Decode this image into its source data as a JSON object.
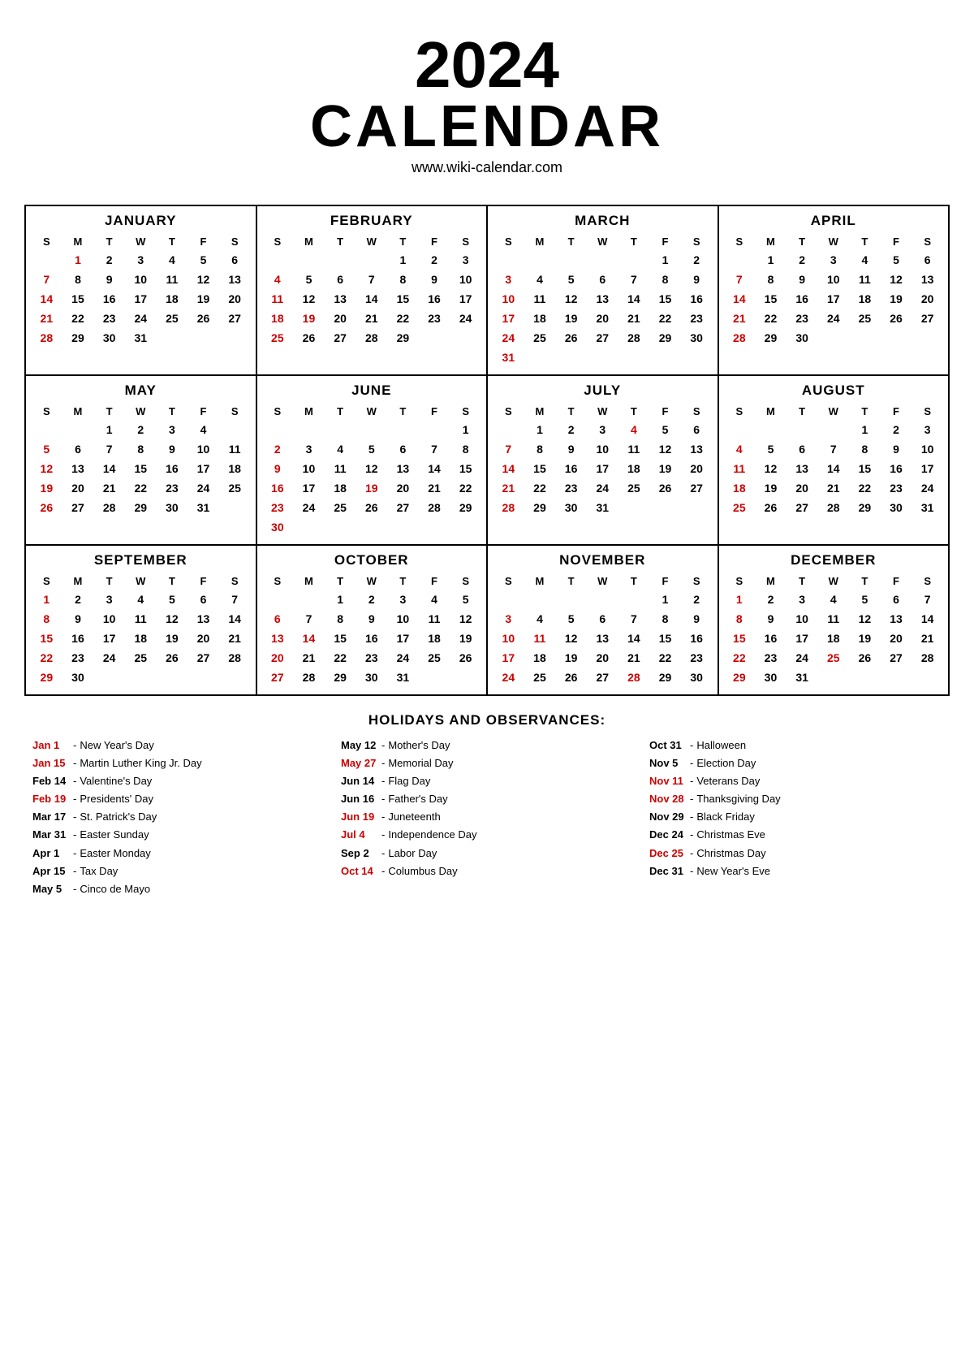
{
  "header": {
    "year": "2024",
    "calendar_word": "CALENDAR",
    "website": "www.wiki-calendar.com"
  },
  "months": [
    {
      "name": "JANUARY",
      "weeks": [
        [
          "",
          1,
          2,
          3,
          4,
          5,
          6
        ],
        [
          7,
          8,
          9,
          10,
          11,
          12,
          13
        ],
        [
          14,
          15,
          16,
          17,
          18,
          19,
          20
        ],
        [
          21,
          22,
          23,
          24,
          25,
          26,
          27
        ],
        [
          28,
          29,
          30,
          31,
          "",
          "",
          ""
        ]
      ]
    },
    {
      "name": "FEBRUARY",
      "weeks": [
        [
          "",
          "",
          "",
          "",
          1,
          2,
          3
        ],
        [
          4,
          5,
          6,
          7,
          8,
          9,
          10
        ],
        [
          11,
          12,
          13,
          14,
          15,
          16,
          17
        ],
        [
          18,
          19,
          20,
          21,
          22,
          23,
          24
        ],
        [
          25,
          26,
          27,
          28,
          29,
          "",
          ""
        ]
      ]
    },
    {
      "name": "MARCH",
      "weeks": [
        [
          "",
          "",
          "",
          "",
          "",
          1,
          2
        ],
        [
          3,
          4,
          5,
          6,
          7,
          8,
          9
        ],
        [
          10,
          11,
          12,
          13,
          14,
          15,
          16
        ],
        [
          17,
          18,
          19,
          20,
          21,
          22,
          23
        ],
        [
          24,
          25,
          26,
          27,
          28,
          29,
          30
        ],
        [
          31,
          "",
          "",
          "",
          "",
          "",
          ""
        ]
      ]
    },
    {
      "name": "APRIL",
      "weeks": [
        [
          "",
          1,
          2,
          3,
          4,
          5,
          6
        ],
        [
          7,
          8,
          9,
          10,
          11,
          12,
          13
        ],
        [
          14,
          15,
          16,
          17,
          18,
          19,
          20
        ],
        [
          21,
          22,
          23,
          24,
          25,
          26,
          27
        ],
        [
          28,
          29,
          30,
          "",
          "",
          "",
          ""
        ]
      ]
    },
    {
      "name": "MAY",
      "weeks": [
        [
          "",
          "",
          1,
          2,
          3,
          4,
          ""
        ],
        [
          5,
          6,
          7,
          8,
          9,
          10,
          11
        ],
        [
          12,
          13,
          14,
          15,
          16,
          17,
          18
        ],
        [
          19,
          20,
          21,
          22,
          23,
          24,
          25
        ],
        [
          26,
          27,
          28,
          29,
          30,
          31,
          ""
        ]
      ]
    },
    {
      "name": "JUNE",
      "weeks": [
        [
          "",
          "",
          "",
          "",
          "",
          "",
          1
        ],
        [
          2,
          3,
          4,
          5,
          6,
          7,
          8
        ],
        [
          9,
          10,
          11,
          12,
          13,
          14,
          15
        ],
        [
          16,
          17,
          18,
          19,
          20,
          21,
          22
        ],
        [
          23,
          24,
          25,
          26,
          27,
          28,
          29
        ],
        [
          30,
          "",
          "",
          "",
          "",
          "",
          ""
        ]
      ]
    },
    {
      "name": "JULY",
      "weeks": [
        [
          "",
          1,
          2,
          3,
          4,
          5,
          6
        ],
        [
          7,
          8,
          9,
          10,
          11,
          12,
          13
        ],
        [
          14,
          15,
          16,
          17,
          18,
          19,
          20
        ],
        [
          21,
          22,
          23,
          24,
          25,
          26,
          27
        ],
        [
          28,
          29,
          30,
          31,
          "",
          "",
          ""
        ]
      ]
    },
    {
      "name": "AUGUST",
      "weeks": [
        [
          "",
          "",
          "",
          "",
          1,
          2,
          3
        ],
        [
          4,
          5,
          6,
          7,
          8,
          9,
          10
        ],
        [
          11,
          12,
          13,
          14,
          15,
          16,
          17
        ],
        [
          18,
          19,
          20,
          21,
          22,
          23,
          24
        ],
        [
          25,
          26,
          27,
          28,
          29,
          30,
          31
        ]
      ]
    },
    {
      "name": "SEPTEMBER",
      "weeks": [
        [
          1,
          2,
          3,
          4,
          5,
          6,
          7
        ],
        [
          8,
          9,
          10,
          11,
          12,
          13,
          14
        ],
        [
          15,
          16,
          17,
          18,
          19,
          20,
          21
        ],
        [
          22,
          23,
          24,
          25,
          26,
          27,
          28
        ],
        [
          29,
          30,
          "",
          "",
          "",
          "",
          ""
        ]
      ]
    },
    {
      "name": "OCTOBER",
      "weeks": [
        [
          "",
          "",
          1,
          2,
          3,
          4,
          5
        ],
        [
          6,
          7,
          8,
          9,
          10,
          11,
          12
        ],
        [
          13,
          14,
          15,
          16,
          17,
          18,
          19
        ],
        [
          20,
          21,
          22,
          23,
          24,
          25,
          26
        ],
        [
          27,
          28,
          29,
          30,
          31,
          "",
          ""
        ]
      ]
    },
    {
      "name": "NOVEMBER",
      "weeks": [
        [
          "",
          "",
          "",
          "",
          "",
          1,
          2
        ],
        [
          3,
          4,
          5,
          6,
          7,
          8,
          9
        ],
        [
          10,
          11,
          12,
          13,
          14,
          15,
          16
        ],
        [
          17,
          18,
          19,
          20,
          21,
          22,
          23
        ],
        [
          24,
          25,
          26,
          27,
          28,
          29,
          30
        ]
      ]
    },
    {
      "name": "DECEMBER",
      "weeks": [
        [
          1,
          2,
          3,
          4,
          5,
          6,
          7
        ],
        [
          8,
          9,
          10,
          11,
          12,
          13,
          14
        ],
        [
          15,
          16,
          17,
          18,
          19,
          20,
          21
        ],
        [
          22,
          23,
          24,
          25,
          26,
          27,
          28
        ],
        [
          29,
          30,
          31,
          "",
          "",
          "",
          ""
        ]
      ]
    }
  ],
  "red_days": {
    "JANUARY": [
      1,
      7,
      14,
      21,
      28
    ],
    "FEBRUARY": [
      4,
      11,
      18,
      25,
      19
    ],
    "MARCH": [
      3,
      10,
      17,
      24,
      31
    ],
    "APRIL": [
      7,
      14,
      21,
      28
    ],
    "MAY": [
      5,
      12,
      19,
      26
    ],
    "JUNE": [
      2,
      9,
      16,
      23,
      30,
      19
    ],
    "JULY": [
      7,
      14,
      21,
      28,
      4
    ],
    "AUGUST": [
      4,
      11,
      18,
      25
    ],
    "SEPTEMBER": [
      1,
      8,
      15,
      22,
      29
    ],
    "OCTOBER": [
      6,
      13,
      20,
      27,
      14
    ],
    "NOVEMBER": [
      3,
      10,
      17,
      24,
      11,
      28
    ],
    "DECEMBER": [
      1,
      8,
      15,
      22,
      29,
      25
    ]
  },
  "day_headers": [
    "S",
    "M",
    "T",
    "W",
    "T",
    "F",
    "S"
  ],
  "holidays_title": "HOLIDAYS AND OBSERVANCES:",
  "holidays": {
    "col1": [
      {
        "date": "Jan 1",
        "red": true,
        "name": "New Year's Day"
      },
      {
        "date": "Jan 15",
        "red": true,
        "name": "Martin Luther King Jr. Day"
      },
      {
        "date": "Feb 14",
        "red": false,
        "name": "Valentine's Day"
      },
      {
        "date": "Feb 19",
        "red": true,
        "name": "Presidents' Day"
      },
      {
        "date": "Mar 17",
        "red": false,
        "name": "St. Patrick's Day"
      },
      {
        "date": "Mar 31",
        "red": false,
        "name": "Easter Sunday"
      },
      {
        "date": "Apr 1",
        "red": false,
        "name": "Easter Monday"
      },
      {
        "date": "Apr 15",
        "red": false,
        "name": "Tax Day"
      },
      {
        "date": "May 5",
        "red": false,
        "name": "Cinco de Mayo"
      }
    ],
    "col2": [
      {
        "date": "May 12",
        "red": false,
        "name": "Mother's Day"
      },
      {
        "date": "May 27",
        "red": true,
        "name": "Memorial Day"
      },
      {
        "date": "Jun 14",
        "red": false,
        "name": "Flag Day"
      },
      {
        "date": "Jun 16",
        "red": false,
        "name": "Father's Day"
      },
      {
        "date": "Jun 19",
        "red": true,
        "name": "Juneteenth"
      },
      {
        "date": "Jul 4",
        "red": true,
        "name": "Independence Day"
      },
      {
        "date": "Sep 2",
        "red": false,
        "name": "Labor Day"
      },
      {
        "date": "Oct 14",
        "red": true,
        "name": "Columbus Day"
      }
    ],
    "col3": [
      {
        "date": "Oct 31",
        "red": false,
        "name": "Halloween"
      },
      {
        "date": "Nov 5",
        "red": false,
        "name": "Election Day"
      },
      {
        "date": "Nov 11",
        "red": true,
        "name": "Veterans Day"
      },
      {
        "date": "Nov 28",
        "red": true,
        "name": "Thanksgiving Day"
      },
      {
        "date": "Nov 29",
        "red": false,
        "name": "Black Friday"
      },
      {
        "date": "Dec 24",
        "red": false,
        "name": "Christmas Eve"
      },
      {
        "date": "Dec 25",
        "red": true,
        "name": "Christmas Day"
      },
      {
        "date": "Dec 31",
        "red": false,
        "name": "New Year's Eve"
      }
    ]
  }
}
